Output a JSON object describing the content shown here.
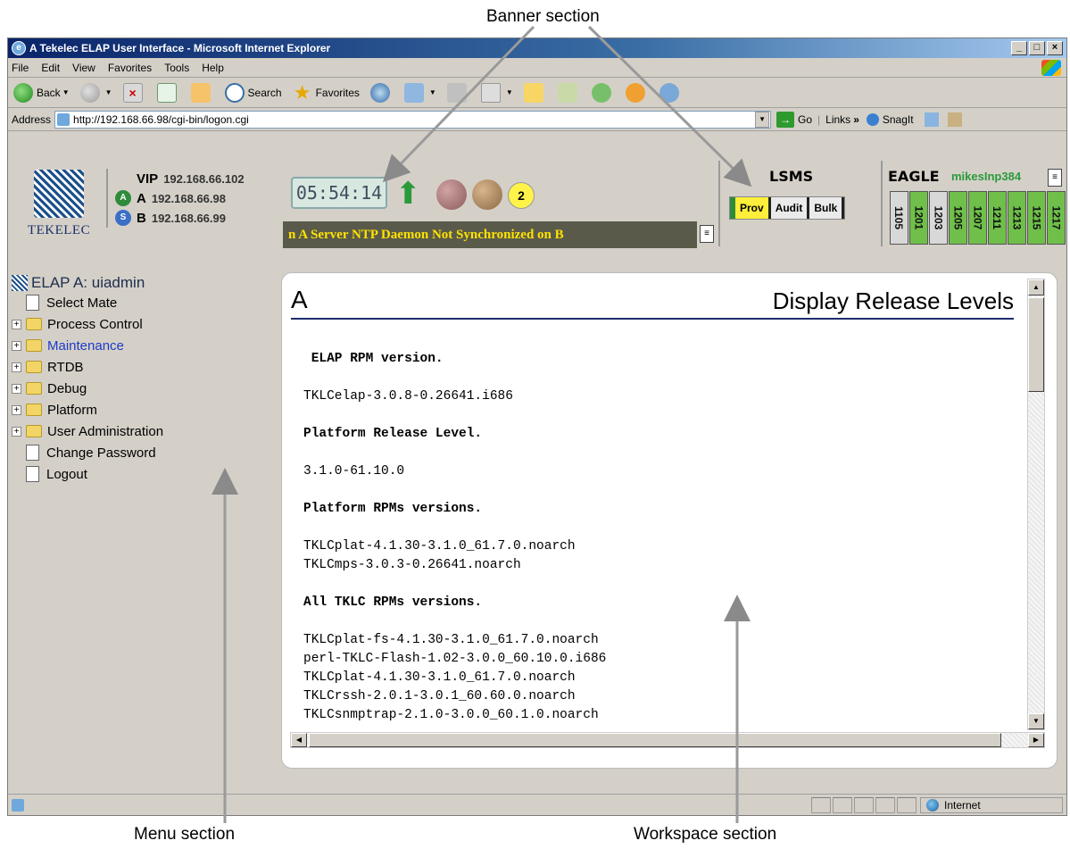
{
  "callouts": {
    "banner": "Banner section",
    "menu": "Menu section",
    "workspace": "Workspace section"
  },
  "window": {
    "title": "A Tekelec ELAP User Interface - Microsoft Internet Explorer",
    "buttons": [
      "_",
      "□",
      "×"
    ]
  },
  "menubar": [
    "File",
    "Edit",
    "View",
    "Favorites",
    "Tools",
    "Help"
  ],
  "toolbar": {
    "back": "Back",
    "search": "Search",
    "favorites": "Favorites"
  },
  "addressbar": {
    "label": "Address",
    "url": "http://192.168.66.98/cgi-bin/logon.cgi",
    "go": "Go",
    "links": "Links",
    "chevron": "»",
    "snagit": "SnagIt"
  },
  "banner": {
    "logo_text": "TEKELEC",
    "vip_label": "VIP",
    "vip_ip": "192.168.66.102",
    "a_label": "A",
    "a_badge": "A",
    "a_ip": "192.168.66.98",
    "b_label": "B",
    "b_badge": "S",
    "b_ip": "192.168.66.99",
    "clock": "05:54:14",
    "alarm_count": "2",
    "alarm_text": "n A       Server NTP Daemon Not Synchronized on B",
    "lsms_title": "LSMS",
    "lsms_tabs": [
      "Prov",
      "Audit",
      "Bulk"
    ],
    "eagle_title": "EAGLE",
    "eagle_host": "mikesInp384",
    "eagle_cards": [
      "1105",
      "1201",
      "1203",
      "1205",
      "1207",
      "1211",
      "1213",
      "1215",
      "1217"
    ]
  },
  "menu": {
    "header": "ELAP A: uiadmin",
    "items": [
      {
        "label": "Select Mate",
        "type": "doc"
      },
      {
        "label": "Process Control",
        "type": "folder"
      },
      {
        "label": "Maintenance",
        "type": "folder"
      },
      {
        "label": "RTDB",
        "type": "folder"
      },
      {
        "label": "Debug",
        "type": "folder"
      },
      {
        "label": "Platform",
        "type": "folder"
      },
      {
        "label": "User Administration",
        "type": "folder"
      },
      {
        "label": "Change Password",
        "type": "doc"
      },
      {
        "label": "Logout",
        "type": "doc"
      }
    ]
  },
  "workspace": {
    "server_label": "A",
    "title": "Display Release Levels",
    "sections": [
      {
        "heading": " ELAP RPM version.",
        "lines": [
          "TKLCelap-3.0.8-0.26641.i686"
        ]
      },
      {
        "heading": "Platform Release Level.",
        "lines": [
          "3.1.0-61.10.0"
        ]
      },
      {
        "heading": "Platform RPMs versions.",
        "lines": [
          "TKLCplat-4.1.30-3.1.0_61.7.0.noarch",
          "TKLCmps-3.0.3-0.26641.noarch"
        ]
      },
      {
        "heading": "All TKLC RPMs versions.",
        "lines": [
          "TKLCplat-fs-4.1.30-3.1.0_61.7.0.noarch",
          "perl-TKLC-Flash-1.02-3.0.0_60.10.0.i686",
          "TKLCplat-4.1.30-3.1.0_61.7.0.noarch",
          "TKLCrssh-2.0.1-3.0.1_60.60.0.noarch",
          "TKLCsnmptrap-2.1.0-3.0.0_60.1.0.noarch"
        ]
      }
    ]
  },
  "statusbar": {
    "zone": "Internet"
  }
}
